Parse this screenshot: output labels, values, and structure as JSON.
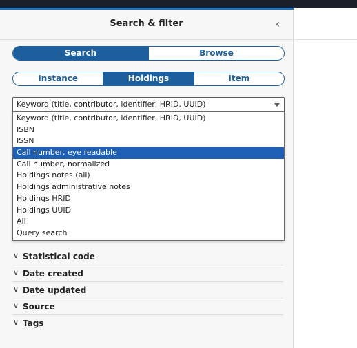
{
  "panel": {
    "title": "Search & filter",
    "collapse_icon": "chevron-left-icon",
    "collapse_glyph": "‹"
  },
  "mode_toggle": [
    {
      "label": "Search",
      "active": true
    },
    {
      "label": "Browse",
      "active": false
    }
  ],
  "segment_tabs": [
    {
      "label": "Instance",
      "active": false
    },
    {
      "label": "Holdings",
      "active": true
    },
    {
      "label": "Item",
      "active": false
    }
  ],
  "search_option_select": {
    "selected_value": "Keyword (title, contributor, identifier, HRID, UUID)",
    "options": [
      {
        "label": "Keyword (title, contributor, identifier, HRID, UUID)",
        "highlighted": false
      },
      {
        "label": "ISBN",
        "highlighted": false
      },
      {
        "label": "ISSN",
        "highlighted": false
      },
      {
        "label": "Call number, eye readable",
        "highlighted": true
      },
      {
        "label": "Call number, normalized",
        "highlighted": false
      },
      {
        "label": "Holdings notes (all)",
        "highlighted": false
      },
      {
        "label": "Holdings administrative notes",
        "highlighted": false
      },
      {
        "label": "Holdings HRID",
        "highlighted": false
      },
      {
        "label": "Holdings UUID",
        "highlighted": false
      },
      {
        "label": "All",
        "highlighted": false
      },
      {
        "label": "Query search",
        "highlighted": false
      }
    ]
  },
  "filters": [
    {
      "label": "Statistical code"
    },
    {
      "label": "Date created"
    },
    {
      "label": "Date updated"
    },
    {
      "label": "Source"
    },
    {
      "label": "Tags"
    }
  ],
  "accordion_glyph": "∨",
  "colors": {
    "accent": "#1c5f9c",
    "highlight": "#1c5fb4",
    "topbar": "#1b1f2a"
  }
}
